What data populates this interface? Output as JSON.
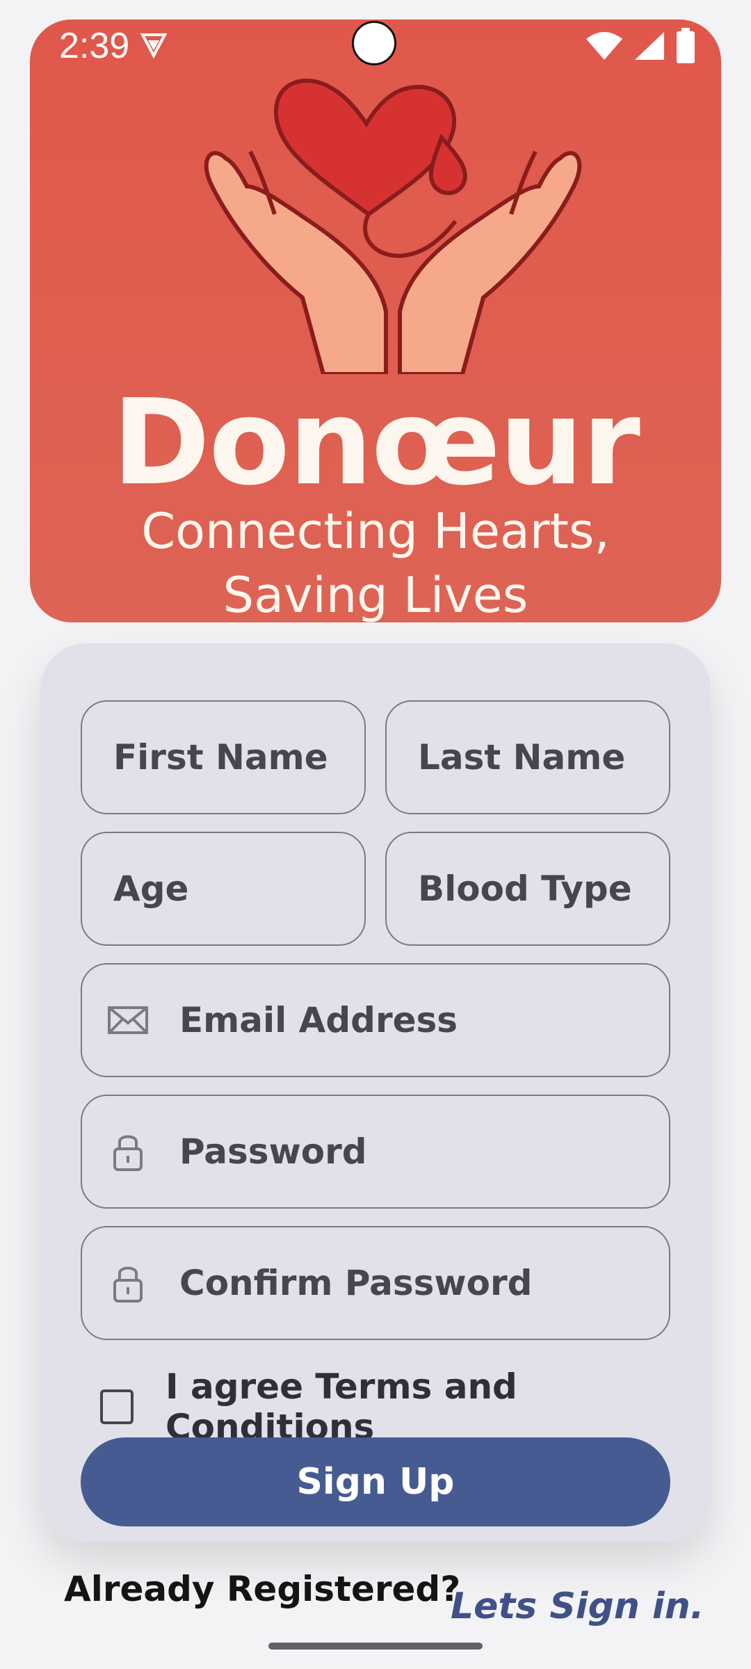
{
  "status_bar": {
    "time": "2:39"
  },
  "header": {
    "brand": "Donœur",
    "tagline_line1": "Connecting Hearts,",
    "tagline_line2": "Saving Lives"
  },
  "form": {
    "first_name": "First Name",
    "last_name": "Last Name",
    "age": "Age",
    "blood_type": "Blood Type",
    "email": "Email Address",
    "password": "Password",
    "confirm_password": "Confirm Password",
    "terms_label": "I agree Terms and Conditions",
    "terms_checked": false,
    "signup_label": "Sign Up"
  },
  "footer": {
    "already": "Already Registered?",
    "signin": "Lets Sign in."
  },
  "icons": {
    "email": "envelope-icon",
    "password": "lock-icon",
    "confirm_password": "lock-icon"
  },
  "colors": {
    "header_red": "#e0584b",
    "button_blue": "#465b91",
    "card_bg": "#e2e1ea"
  }
}
